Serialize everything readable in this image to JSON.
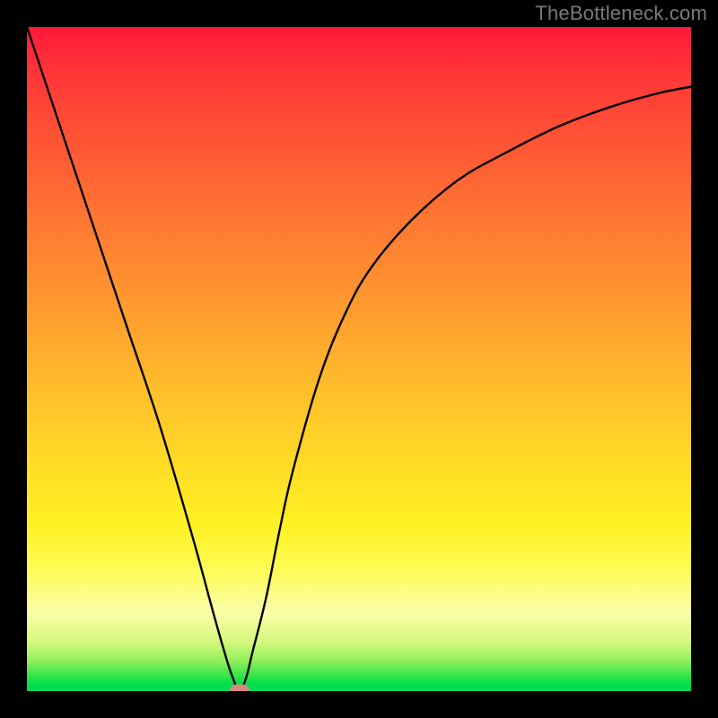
{
  "attribution": "TheBottleneck.com",
  "chart_data": {
    "type": "line",
    "title": "",
    "xlabel": "",
    "ylabel": "",
    "xlim": [
      0,
      100
    ],
    "ylim": [
      0,
      100
    ],
    "x": [
      0,
      5,
      10,
      15,
      20,
      25,
      28,
      30,
      31,
      32,
      33,
      34,
      36,
      38,
      40,
      44,
      48,
      52,
      58,
      65,
      72,
      80,
      88,
      95,
      100
    ],
    "values": [
      100,
      85,
      70,
      55,
      40,
      23,
      12,
      5,
      2,
      0,
      2,
      6,
      14,
      24,
      33,
      47,
      57,
      64,
      71,
      77,
      81,
      85,
      88,
      90,
      91
    ],
    "series": [
      {
        "name": "bottleneck-curve",
        "x_ref": "x",
        "y_ref": "values"
      }
    ],
    "marker": {
      "x": 32,
      "y": 0
    },
    "background_gradient": {
      "stops": [
        {
          "pos": 0,
          "color": "#ff193a"
        },
        {
          "pos": 0.5,
          "color": "#ffb12c"
        },
        {
          "pos": 0.78,
          "color": "#fff123"
        },
        {
          "pos": 0.9,
          "color": "#fcfeaa"
        },
        {
          "pos": 1.0,
          "color": "#00db56"
        }
      ]
    }
  }
}
